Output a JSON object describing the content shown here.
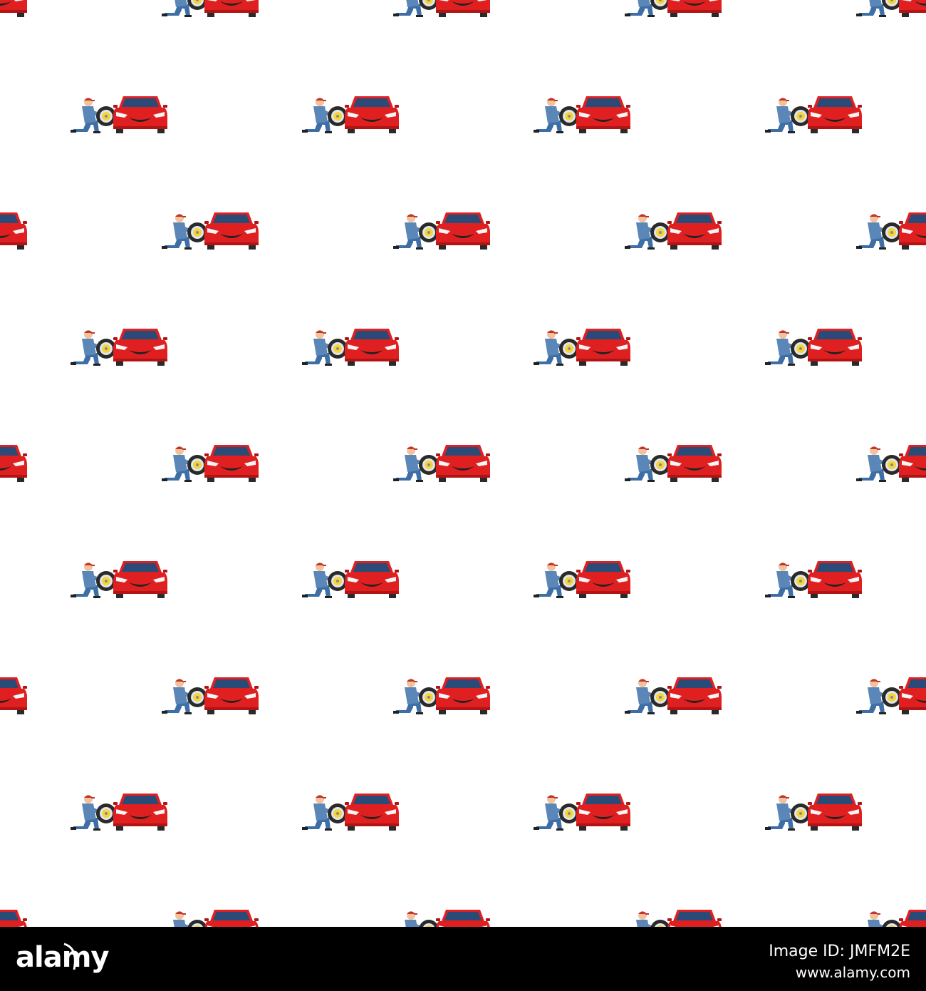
{
  "pattern": {
    "background": "#ffffff",
    "motif": "mechanic-changing-tire-beside-red-car",
    "columns_per_row": 4,
    "rows": 9,
    "colors": {
      "car_body": "#e02020",
      "car_dark": "#b01414",
      "car_window": "#2a4a78",
      "mechanic_shirt": "#5a86b8",
      "mechanic_pants": "#3d6ea6",
      "mechanic_cap": "#c0332e",
      "mechanic_skin": "#f2c29a",
      "tire": "#2a2a2a",
      "rim": "#f5d43a"
    }
  },
  "watermark": {
    "brand": "alamy",
    "image_id_label": "Image ID:",
    "image_id": "JMFM2E",
    "url": "www.alamy.com",
    "colors": {
      "bar": "#000000",
      "text": "#ffffff"
    }
  }
}
